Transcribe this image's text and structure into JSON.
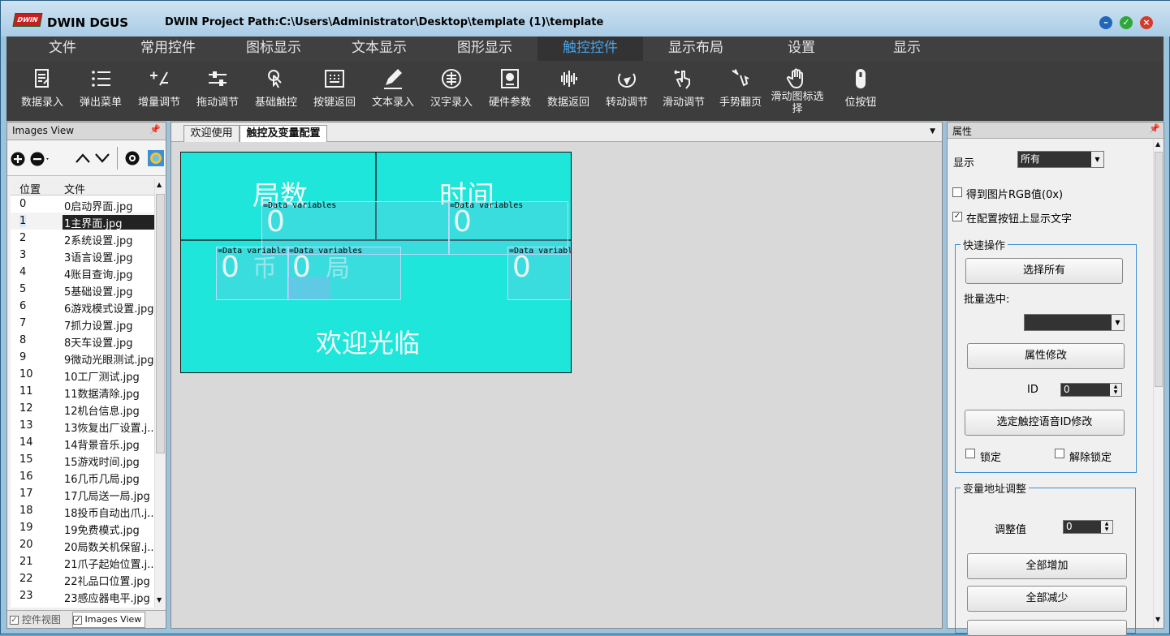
{
  "window": {
    "logo_text": "DWIN",
    "app_title": "DWIN DGUS",
    "project_path": "DWIN Project Path:C:\\Users\\Administrator\\Desktop\\template (1)\\template"
  },
  "menu": [
    "文件",
    "常用控件",
    "图标显示",
    "文本显示",
    "图形显示",
    "触控控件",
    "显示布局",
    "设置",
    "显示"
  ],
  "menu_active_index": 5,
  "toolbar": [
    {
      "label": "数据录入",
      "icon": "data-entry-icon"
    },
    {
      "label": "弹出菜单",
      "icon": "popup-menu-icon"
    },
    {
      "label": "增量调节",
      "icon": "increment-icon"
    },
    {
      "label": "拖动调节",
      "icon": "slider-icon"
    },
    {
      "label": "基础触控",
      "icon": "touch-icon"
    },
    {
      "label": "按键返回",
      "icon": "keypad-icon"
    },
    {
      "label": "文本录入",
      "icon": "pen-icon"
    },
    {
      "label": "汉字录入",
      "icon": "chinese-input-icon"
    },
    {
      "label": "硬件参数",
      "icon": "hardware-icon"
    },
    {
      "label": "数据返回",
      "icon": "waveform-icon"
    },
    {
      "label": "转动调节",
      "icon": "rotate-icon"
    },
    {
      "label": "滑动调节",
      "icon": "swipe-icon"
    },
    {
      "label": "手势翻页",
      "icon": "gesture-icon"
    },
    {
      "label": "滑动图标选择",
      "icon": "hand-icon"
    },
    {
      "label": "位按钮",
      "icon": "bit-button-icon"
    }
  ],
  "left_panel": {
    "title": "Images View",
    "col_pos": "位置",
    "col_file": "文件",
    "rows": [
      {
        "pos": "0",
        "file": "0启动界面.jpg"
      },
      {
        "pos": "1",
        "file": "1主界面.jpg"
      },
      {
        "pos": "2",
        "file": "2系统设置.jpg"
      },
      {
        "pos": "3",
        "file": "3语言设置.jpg"
      },
      {
        "pos": "4",
        "file": "4账目查询.jpg"
      },
      {
        "pos": "5",
        "file": "5基础设置.jpg"
      },
      {
        "pos": "6",
        "file": "6游戏模式设置.jpg"
      },
      {
        "pos": "7",
        "file": "7抓力设置.jpg"
      },
      {
        "pos": "8",
        "file": "8天车设置.jpg"
      },
      {
        "pos": "9",
        "file": "9微动光眼测试.jpg"
      },
      {
        "pos": "10",
        "file": "10工厂测试.jpg"
      },
      {
        "pos": "11",
        "file": "11数据清除.jpg"
      },
      {
        "pos": "12",
        "file": "12机台信息.jpg"
      },
      {
        "pos": "13",
        "file": "13恢复出厂设置.j..."
      },
      {
        "pos": "14",
        "file": "14背景音乐.jpg"
      },
      {
        "pos": "15",
        "file": "15游戏时间.jpg"
      },
      {
        "pos": "16",
        "file": "16几币几局.jpg"
      },
      {
        "pos": "17",
        "file": "17几局送一局.jpg"
      },
      {
        "pos": "18",
        "file": "18投币自动出爪.j..."
      },
      {
        "pos": "19",
        "file": "19免费模式.jpg"
      },
      {
        "pos": "20",
        "file": "20局数关机保留.j..."
      },
      {
        "pos": "21",
        "file": "21爪子起始位置.j..."
      },
      {
        "pos": "22",
        "file": "22礼品口位置.jpg"
      },
      {
        "pos": "23",
        "file": "23感应器电平.jpg"
      }
    ],
    "selected_index": 1,
    "bottom_tabs": [
      "控件视图",
      "Images View"
    ]
  },
  "center": {
    "tabs": [
      "欢迎使用",
      "触控及变量配置"
    ],
    "active_tab": 1,
    "canvas": {
      "label_rounds": "局数",
      "label_time": "时间",
      "label_coin": "币",
      "label_round": "局",
      "welcome": "欢迎光临",
      "dv_label": "Data variables",
      "dv_label_cut": "Data variable",
      "dv_label_cut2": "Data variabl",
      "dv_value": "0"
    }
  },
  "right_panel": {
    "title": "属性",
    "display_label": "显示",
    "display_value": "所有",
    "rgb_label": "得到图片RGB值(0x)",
    "rgb_checked": false,
    "show_text_label": "在配置按钮上显示文字",
    "show_text_checked": true,
    "quick_ops": "快速操作",
    "select_all": "选择所有",
    "batch_select": "批量选中:",
    "modify_props": "属性修改",
    "id_label": "ID",
    "id_value": "0",
    "voice_btn": "选定触控语音ID修改",
    "lock": "锁定",
    "unlock": "解除锁定",
    "addr_group": "变量地址调整",
    "adjust_label": "调整值",
    "adjust_value": "0",
    "add_all": "全部增加",
    "sub_all": "全部减少"
  }
}
